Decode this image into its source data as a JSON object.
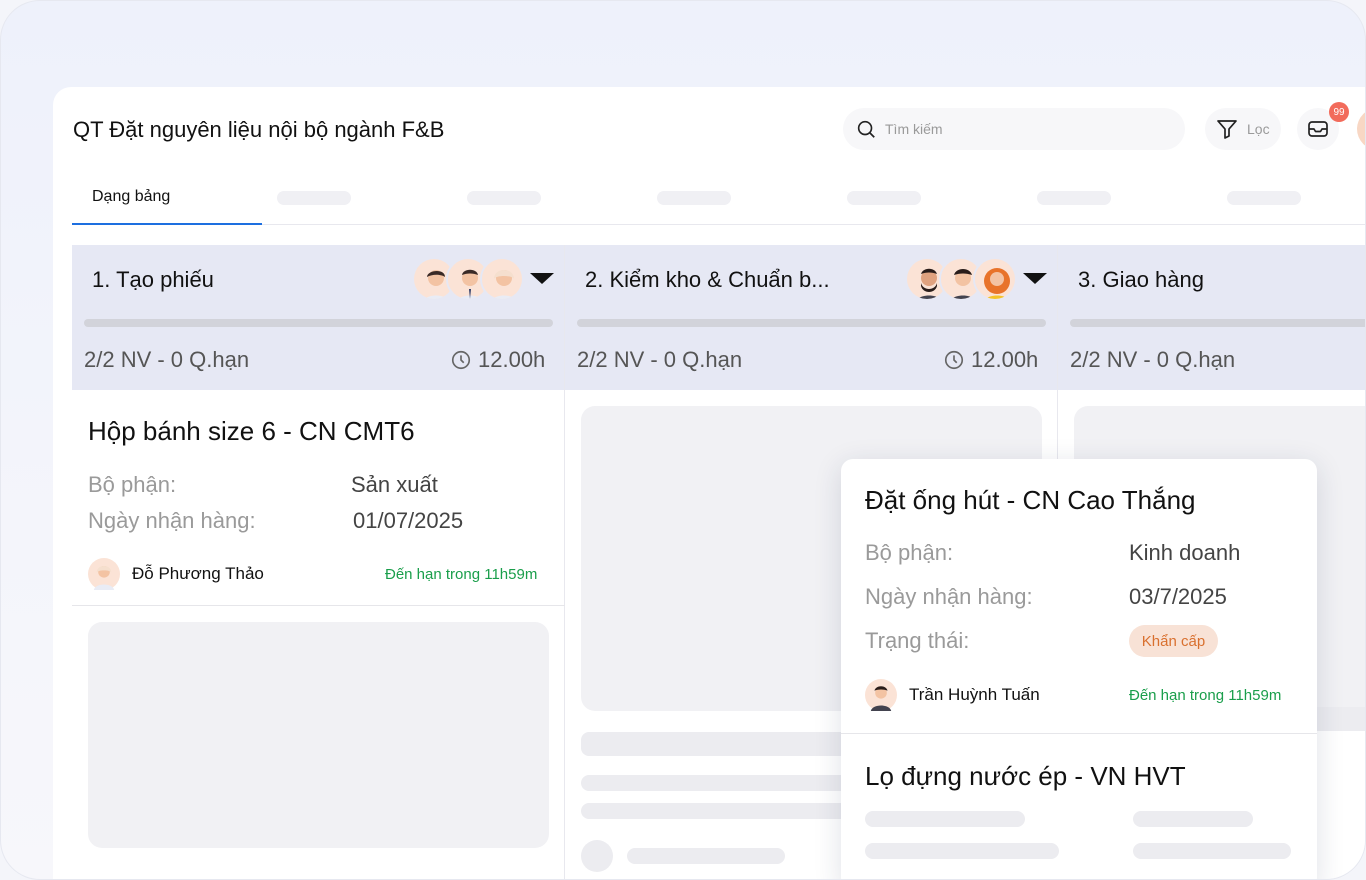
{
  "header": {
    "title": "QT Đặt nguyên liệu nội bộ ngành F&B",
    "search_placeholder": "Tìm kiếm",
    "filter_label": "Lọc",
    "notification_count": "99"
  },
  "tabs": {
    "active_label": "Dạng bảng"
  },
  "columns": [
    {
      "title": "1. Tạo phiếu",
      "stats": "2/2 NV - 0 Q.hạn",
      "time": "12.00h"
    },
    {
      "title": "2. Kiểm kho & Chuẩn b...",
      "stats": "2/2 NV - 0 Q.hạn",
      "time": "12.00h"
    },
    {
      "title": "3. Giao hàng",
      "stats": "2/2 NV - 0 Q.hạn"
    }
  ],
  "card1": {
    "title": "Hộp bánh size 6 - CN CMT6",
    "dept_label": "Bộ phận:",
    "dept_value": "Sản xuất",
    "date_label": "Ngày nhận hàng:",
    "date_value": "01/07/2025",
    "person": "Đỗ Phương Thảo",
    "due": "Đến hạn trong 11h59m"
  },
  "overlay_card": {
    "title": "Đặt ống hút - CN Cao Thắng",
    "dept_label": "Bộ phận:",
    "dept_value": "Kinh doanh",
    "date_label": "Ngày nhận hàng:",
    "date_value": "03/7/2025",
    "status_label": "Trạng thái:",
    "status_value": "Khẩn cấp",
    "person": "Trần Huỳnh Tuấn",
    "due": "Đến hạn trong 11h59m"
  },
  "overlay_card2": {
    "title": "Lọ đựng nước ép - VN HVT"
  },
  "colors": {
    "accent": "#1d6fe0",
    "due_green": "#1a9e4b",
    "urgent_bg": "#f8e2d6",
    "urgent_text": "#d9702f",
    "column_header_bg": "#e6e8f4",
    "badge": "#f26b5b"
  }
}
